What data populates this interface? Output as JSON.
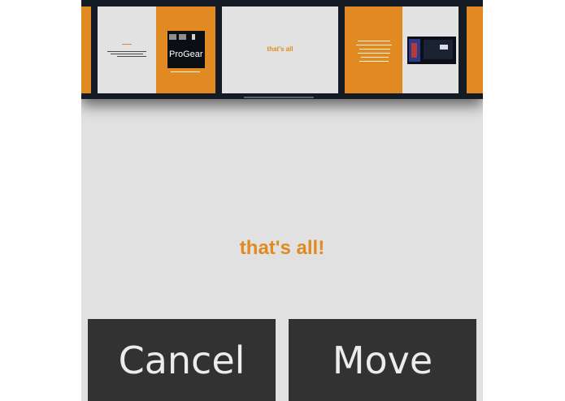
{
  "filmstrip": {
    "thumbnails": [
      {
        "id": "partial-left",
        "layout": "orange"
      },
      {
        "id": "title-logo",
        "layout": "light-orange",
        "logo_text": "ProGear"
      },
      {
        "id": "thats-all-thumb",
        "layout": "light",
        "caption": "that's all"
      },
      {
        "id": "photo-slide",
        "layout": "orange-light"
      },
      {
        "id": "partial-right",
        "layout": "orange"
      }
    ]
  },
  "slide": {
    "title": "that's all!"
  },
  "buttons": {
    "cancel_label": "Cancel",
    "move_label": "Move"
  },
  "colors": {
    "accent": "#e08a21",
    "filmstrip_bg": "#151b24",
    "slide_bg": "#e1e1e1",
    "button_bg": "#323232",
    "button_text": "#ececec"
  }
}
